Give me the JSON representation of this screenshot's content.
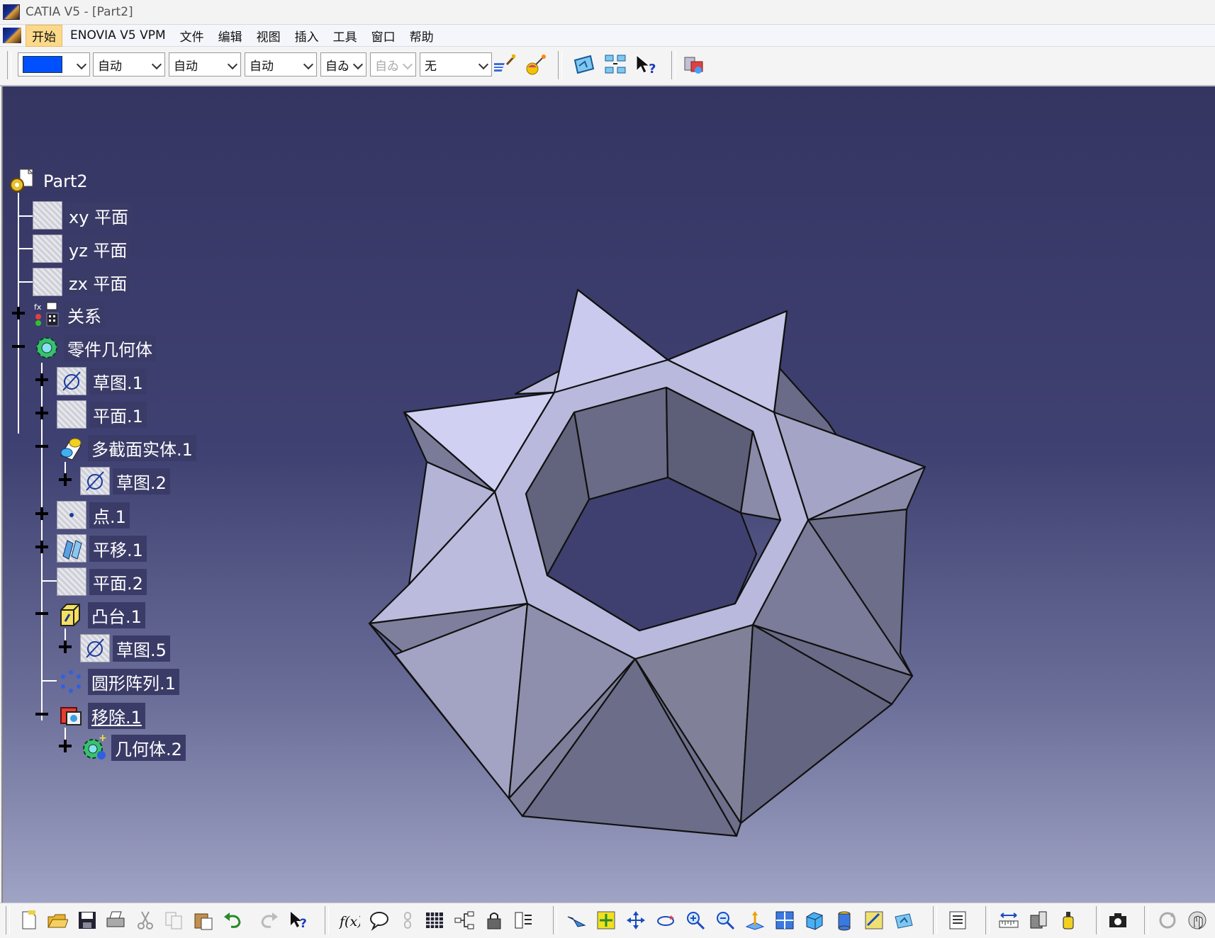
{
  "window": {
    "title": "CATIA V5 - [Part2]"
  },
  "menu": {
    "items": [
      "开始",
      "ENOVIA V5 VPM",
      "文件",
      "编辑",
      "视图",
      "插入",
      "工具",
      "窗口",
      "帮助"
    ]
  },
  "toolbar": {
    "color_swatch": "#0050ff",
    "combos": [
      {
        "value": "自动",
        "enabled": true
      },
      {
        "value": "自动",
        "enabled": true
      },
      {
        "value": "自动",
        "enabled": true
      },
      {
        "value": "自ゐ",
        "enabled": true
      },
      {
        "value": "自ゐ",
        "enabled": false
      },
      {
        "value": "无",
        "enabled": true
      }
    ],
    "icons": [
      "paint-brush-icon",
      "apply-material-icon",
      "hide-show-icon",
      "swap-space-icon",
      "whats-this-icon",
      "catalog-browser-icon"
    ]
  },
  "tree": {
    "root": "Part2",
    "nodes": [
      {
        "label": "xy 平面",
        "icon": "plane-icon"
      },
      {
        "label": "yz 平面",
        "icon": "plane-icon"
      },
      {
        "label": "zx 平面",
        "icon": "plane-icon"
      },
      {
        "label": "关系",
        "icon": "relations-icon",
        "expander": "plus"
      },
      {
        "label": "零件几何体",
        "icon": "part-body-icon",
        "expander": "minus"
      },
      {
        "label": "草图.1",
        "icon": "sketch-icon",
        "expander": "plus"
      },
      {
        "label": "平面.1",
        "icon": "plane-icon",
        "expander": "plus"
      },
      {
        "label": "多截面实体.1",
        "icon": "multi-section-solid-icon",
        "expander": "minus"
      },
      {
        "label": "草图.2",
        "icon": "sketch-icon",
        "expander": "plus"
      },
      {
        "label": "点.1",
        "icon": "point-icon",
        "expander": "plus"
      },
      {
        "label": "平移.1",
        "icon": "translate-icon",
        "expander": "plus"
      },
      {
        "label": "平面.2",
        "icon": "plane-icon"
      },
      {
        "label": "凸台.1",
        "icon": "pad-icon",
        "expander": "minus"
      },
      {
        "label": "草图.5",
        "icon": "sketch-icon",
        "expander": "plus"
      },
      {
        "label": "圆形阵列.1",
        "icon": "circular-pattern-icon"
      },
      {
        "label": "移除.1",
        "icon": "remove-icon",
        "expander": "minus"
      },
      {
        "label": "几何体.2",
        "icon": "body-icon",
        "expander": "plus"
      }
    ]
  },
  "colors": {
    "viewport_top": "#353562",
    "viewport_bottom": "#9fa3c4",
    "tree_label_bg": "#3b3b68",
    "active_menu": "#fcd98a",
    "model_light": "#d4d4f2",
    "model_dark": "#5c5d79"
  },
  "bottom_toolbar": {
    "icons": [
      "new-icon",
      "open-icon",
      "save-icon",
      "print-icon",
      "cut-icon",
      "copy-icon",
      "paste-icon",
      "undo-icon",
      "redo-icon",
      "whats-this-icon",
      "formula-icon",
      "comment-icon",
      "link-icon",
      "table-icon",
      "tree-icon",
      "lock-icon",
      "list-icon",
      "fly-mode-icon",
      "fit-all-icon",
      "pan-icon",
      "rotate-icon",
      "zoom-in-icon",
      "zoom-out-icon",
      "normal-view-icon",
      "multi-view-icon",
      "iso-view-icon",
      "shading-icon",
      "hide-show-icon",
      "swap-space-icon",
      "catalog-icon",
      "measure-icon",
      "measure-item-icon",
      "inertia-icon",
      "capture-icon",
      "update-icon",
      "manipulate-icon"
    ]
  }
}
